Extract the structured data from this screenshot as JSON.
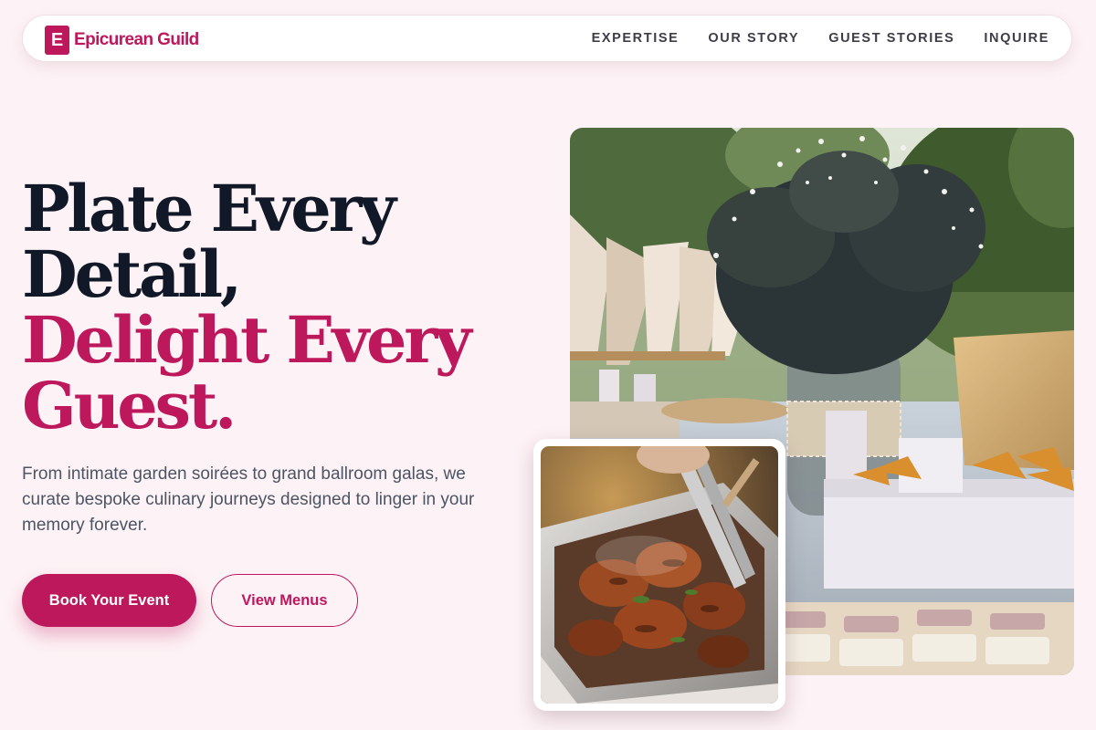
{
  "brand": {
    "letter": "E",
    "name": "Epicurean Guild"
  },
  "nav": {
    "links": [
      "EXPERTISE",
      "OUR STORY",
      "GUEST STORIES",
      "INQUIRE"
    ]
  },
  "hero": {
    "headline_line1": "Plate Every",
    "headline_line2": "Detail,",
    "headline_line3": "Delight Every",
    "headline_line4": "Guest.",
    "description": "From intimate garden soirées to grand ballroom galas, we curate bespoke culinary journeys designed to linger in your memory forever.",
    "primary_cta": "Book Your Event",
    "secondary_cta": "View Menus"
  },
  "colors": {
    "accent": "#be185d",
    "background": "#fdf2f5",
    "heading": "#111827",
    "body_text": "#4b5563"
  }
}
